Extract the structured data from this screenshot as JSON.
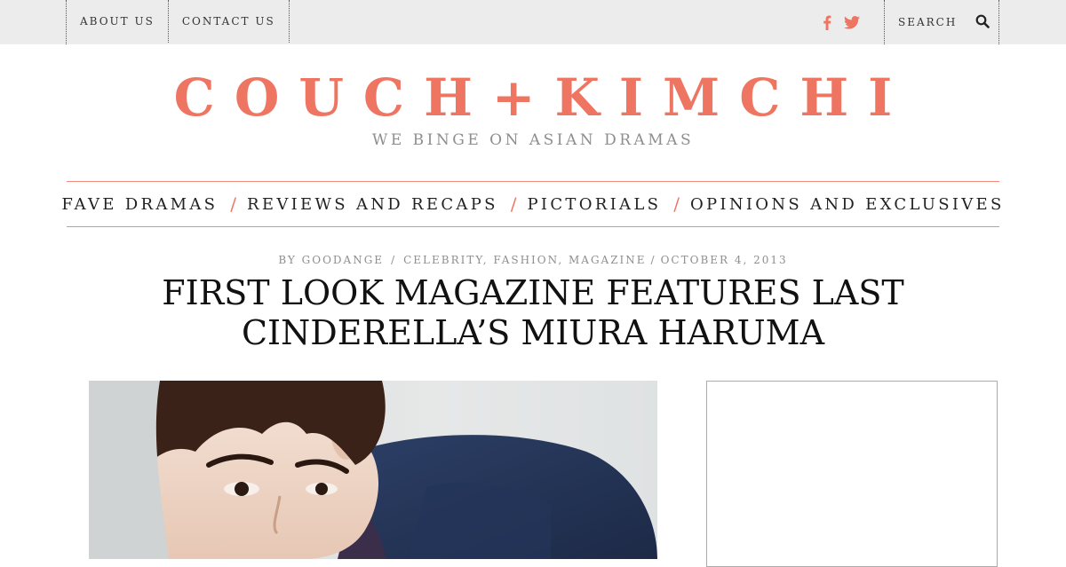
{
  "topbar": {
    "links": [
      {
        "label": "ABOUT US"
      },
      {
        "label": "CONTACT US"
      }
    ],
    "social": [
      "facebook-icon",
      "twitter-icon"
    ],
    "search": {
      "placeholder": "SEARCH"
    }
  },
  "header": {
    "logo": "COUCH+KIMCHI",
    "tagline": "WE BINGE ON ASIAN DRAMAS"
  },
  "mainnav": {
    "items": [
      {
        "label": "FAVE DRAMAS"
      },
      {
        "label": "REVIEWS AND RECAPS"
      },
      {
        "label": "PICTORIALS"
      },
      {
        "label": "OPINIONS AND EXCLUSIVES"
      }
    ],
    "separator": "/"
  },
  "post": {
    "byline": "BY GOODANGE",
    "meta_sep": "/",
    "categories": [
      "CELEBRITY",
      "FASHION",
      "MAGAZINE"
    ],
    "date": "OCTOBER 4, 2013",
    "title": "FIRST LOOK MAGAZINE FEATURES LAST CINDERELLA’S MIURA HARUMA"
  },
  "colors": {
    "accent": "#ef7563",
    "topbar_bg": "#ececec",
    "text": "#222222",
    "muted": "#8e8e8e"
  }
}
